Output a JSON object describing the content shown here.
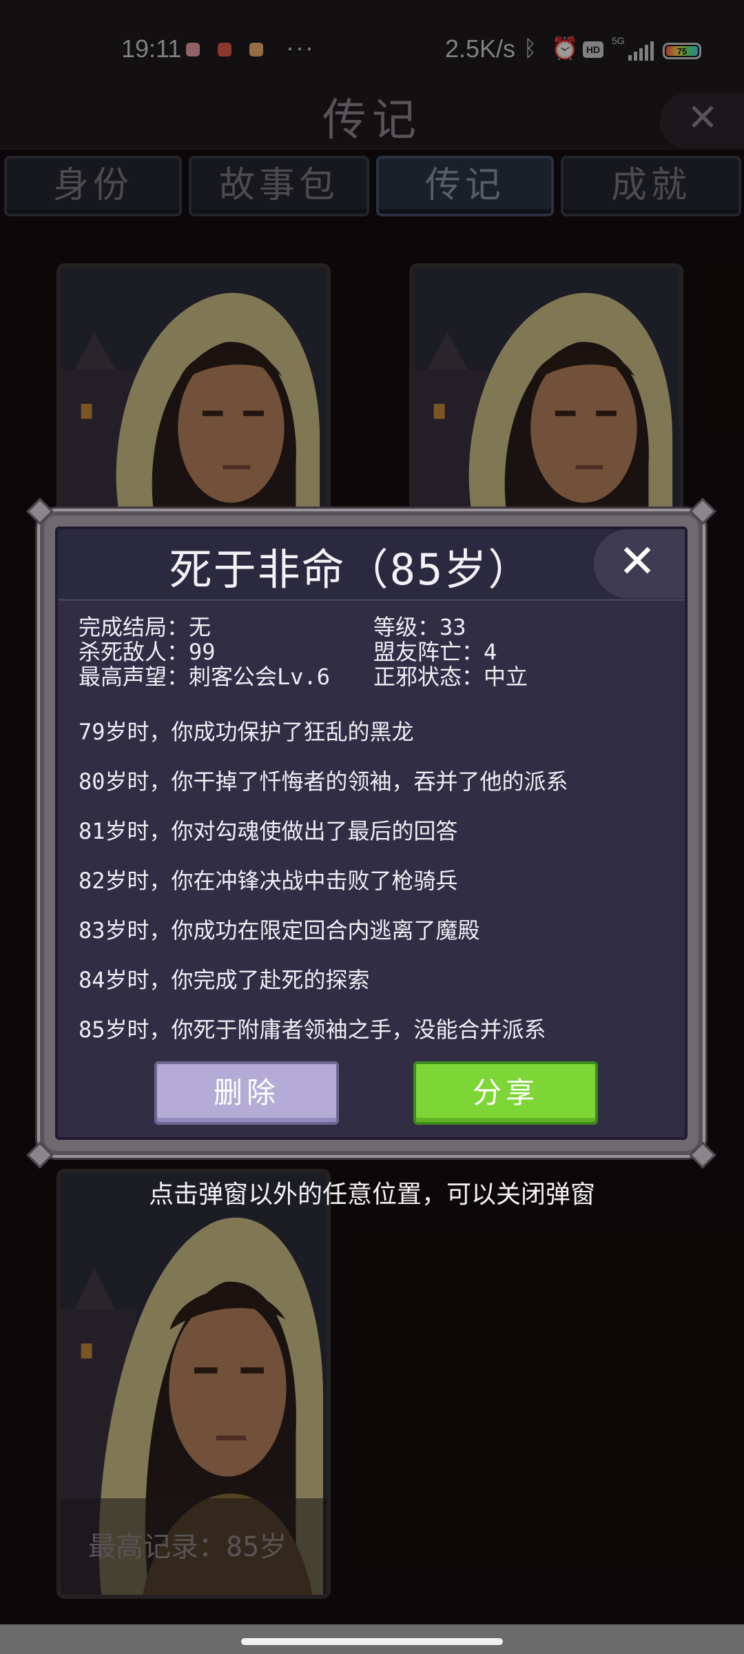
{
  "status_bar": {
    "time": "19:11",
    "dots": "···",
    "net_speed": "2.5K/s",
    "hd": "HD",
    "network": "5G",
    "battery": "75",
    "icons": [
      "bluetooth-icon",
      "alarm-icon",
      "signal-icon",
      "battery-icon"
    ]
  },
  "header": {
    "title": "传记",
    "close": "✕"
  },
  "tabs": [
    {
      "label": "身份",
      "active": false
    },
    {
      "label": "故事包",
      "active": false
    },
    {
      "label": "传记",
      "active": true
    },
    {
      "label": "成就",
      "active": false
    }
  ],
  "cards": {
    "record_label": "最高记录：85岁"
  },
  "modal": {
    "title": "死于非命（85岁）",
    "close": "✕",
    "stats": {
      "ending": "完成结局：无",
      "level": "等级：33",
      "kills": "杀死敌人：99",
      "allies_dead": "盟友阵亡：4",
      "reputation": "最高声望：刺客公会Lv.6",
      "alignment": "正邪状态：中立"
    },
    "events": [
      "79岁时，你成功保护了狂乱的黑龙",
      "80岁时，你干掉了忏悔者的领袖，吞并了他的派系",
      "81岁时，你对勾魂使做出了最后的回答",
      "82岁时，你在冲锋决战中击败了枪骑兵",
      "83岁时，你成功在限定回合内逃离了魔殿",
      "84岁时，你完成了赴死的探索",
      "85岁时，你死于附庸者领袖之手，没能合并派系"
    ],
    "delete_label": "删除",
    "share_label": "分享"
  },
  "hint": "点击弹窗以外的任意位置，可以关闭弹窗",
  "colors": {
    "background": "#140e0f",
    "modal_panel": "#302d45",
    "delete_button": "#b4acd6",
    "share_button": "#7ed636"
  }
}
